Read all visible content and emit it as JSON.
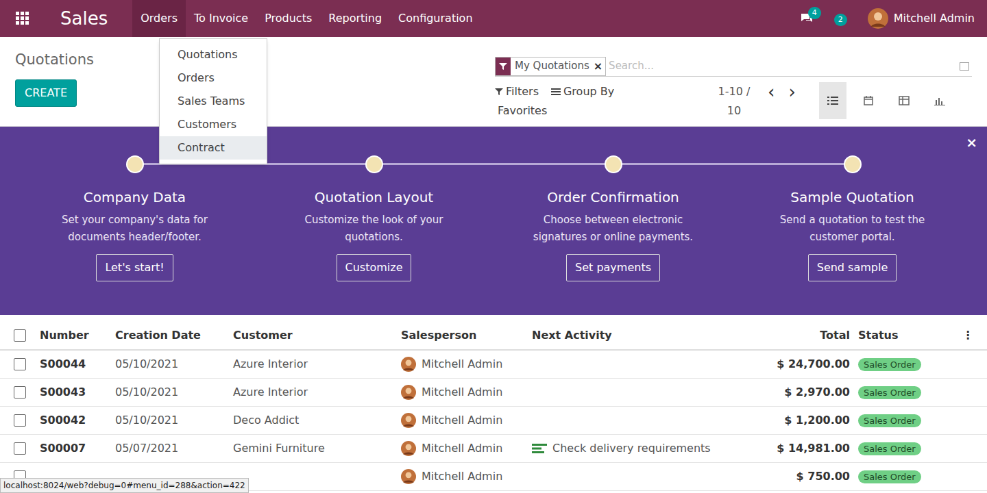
{
  "app": {
    "name": "Sales",
    "menu": [
      {
        "label": "Orders",
        "selected": true
      },
      {
        "label": "To Invoice",
        "selected": false
      },
      {
        "label": "Products",
        "selected": false
      },
      {
        "label": "Reporting",
        "selected": false
      },
      {
        "label": "Configuration",
        "selected": false
      }
    ]
  },
  "systray": {
    "messages": "4",
    "activities": "2",
    "user": "Mitchell Admin"
  },
  "dropdown": {
    "items": [
      {
        "label": "Quotations",
        "selected": false
      },
      {
        "label": "Orders",
        "selected": false
      },
      {
        "label": "Sales Teams",
        "selected": false
      },
      {
        "label": "Customers",
        "selected": false
      },
      {
        "label": "Contract",
        "selected": true
      }
    ]
  },
  "page": {
    "title": "Quotations",
    "create": "CREATE"
  },
  "search": {
    "facet": "My Quotations",
    "facet_remove": "×",
    "placeholder": "Search..."
  },
  "controls": {
    "filters": "Filters",
    "group_by": "Group By",
    "favorites": "Favorites",
    "pager": "1-10 / 10",
    "prev": "‹",
    "next": "›"
  },
  "views": [
    {
      "name": "list",
      "selected": true
    },
    {
      "name": "calendar",
      "selected": false
    },
    {
      "name": "pivot",
      "selected": false
    },
    {
      "name": "graph",
      "selected": false
    }
  ],
  "onboarding": {
    "close": "×",
    "steps": [
      {
        "title": "Company Data",
        "text": "Set your company's data for documents header/footer.",
        "button": "Let's start!"
      },
      {
        "title": "Quotation Layout",
        "text": "Customize the look of your quotations.",
        "button": "Customize"
      },
      {
        "title": "Order Confirmation",
        "text": "Choose between electronic signatures or online payments.",
        "button": "Set payments"
      },
      {
        "title": "Sample Quotation",
        "text": "Send a quotation to test the customer portal.",
        "button": "Send sample"
      }
    ]
  },
  "table": {
    "columns": [
      "Number",
      "Creation Date",
      "Customer",
      "Salesperson",
      "Next Activity",
      "Total",
      "Status"
    ],
    "options": "⋮",
    "rows": [
      {
        "number": "S00044",
        "date": "05/10/2021",
        "customer": "Azure Interior",
        "salesperson": "Mitchell Admin",
        "activity": "",
        "total": "$ 24,700.00",
        "status": "Sales Order",
        "checked": false
      },
      {
        "number": "S00043",
        "date": "05/10/2021",
        "customer": "Azure Interior",
        "salesperson": "Mitchell Admin",
        "activity": "",
        "total": "$ 2,970.00",
        "status": "Sales Order",
        "checked": false
      },
      {
        "number": "S00042",
        "date": "05/10/2021",
        "customer": "Deco Addict",
        "salesperson": "Mitchell Admin",
        "activity": "",
        "total": "$ 1,200.00",
        "status": "Sales Order",
        "checked": false
      },
      {
        "number": "S00007",
        "date": "05/07/2021",
        "customer": "Gemini Furniture",
        "salesperson": "Mitchell Admin",
        "activity": "Check delivery requirements",
        "total": "$ 14,981.00",
        "status": "Sales Order",
        "checked": false
      },
      {
        "number": "",
        "date": "",
        "customer": "",
        "salesperson": "Mitchell Admin",
        "activity": "",
        "total": "$ 750.00",
        "status": "Sales Order",
        "checked": false
      }
    ]
  },
  "status_bar": "localhost:8024/web?debug=0#menu_id=288&action=422"
}
